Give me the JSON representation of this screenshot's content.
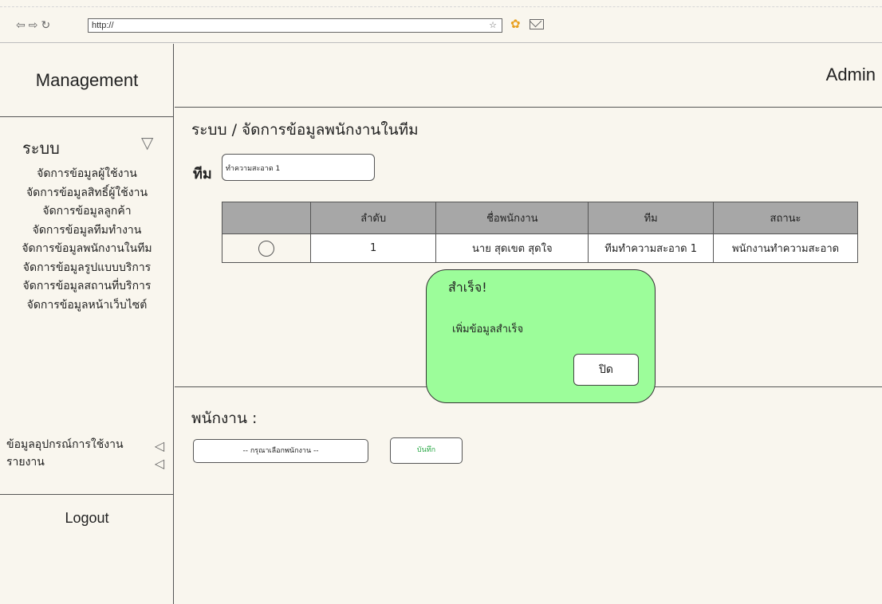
{
  "browser": {
    "url": "http://"
  },
  "sidebar": {
    "brand": "Management",
    "section_title": "ระบบ",
    "items": [
      "จัดการข้อมูลผู้ใช้งาน",
      "จัดการข้อมูลสิทธิ์ผู้ใช้งาน",
      "จัดการข้อมูลลูกค้า",
      "จัดการข้อมูลทีมทำงาน",
      "จัดการข้อมูลพนักงานในทีม",
      "จัดการข้อมูลรูปแบบบริการ",
      "จัดการข้อมูลสถานที่บริการ",
      "จัดการข้อมูลหน้าเว็บไซต์"
    ],
    "groups": [
      "ข้อมูลอุปกรณ์การใช้งาน",
      "รายงาน"
    ],
    "logout": "Logout"
  },
  "header": {
    "user": "Admin"
  },
  "main": {
    "breadcrumb": "ระบบ / จัดการข้อมูลพนักงานในทีม",
    "team_label": "ทีม",
    "team_value": "ทำความสะอาด 1",
    "table": {
      "headers": [
        "",
        "ลำดับ",
        "ชื่อพนักงาน",
        "ทีม",
        "สถานะ"
      ],
      "rows": [
        {
          "order": "1",
          "name": "นาย สุดเขต สุดใจ",
          "team": "ทีมทำความสะอาด 1",
          "status": "พนักงานทำความสะอาด"
        }
      ]
    },
    "employee_label": "พนักงาน :",
    "employee_select": "-- กรุณาเลือกพนักงาน --",
    "save_label": "บันทึก"
  },
  "modal": {
    "title": "สำเร็จ!",
    "message": "เพิ่มข้อมูลสำเร็จ",
    "close_label": "ปิด"
  }
}
